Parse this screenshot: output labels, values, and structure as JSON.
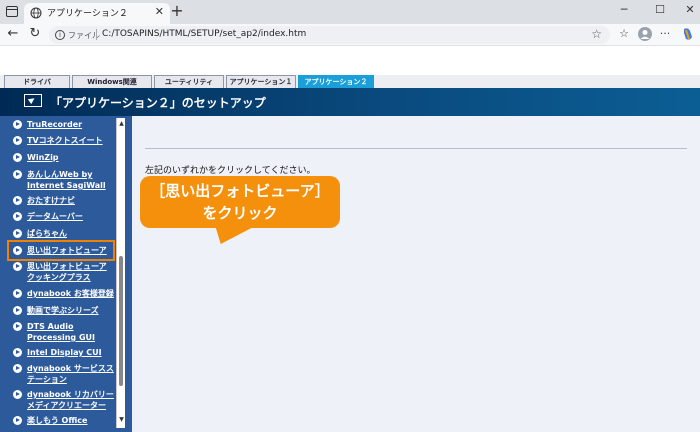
{
  "browser": {
    "tab_title": "アプリケーション２",
    "new_tab": "+",
    "url_scheme": "ファイル",
    "url": "C:/TOSAPINS/HTML/SETUP/set_ap2/index.htm"
  },
  "nav_tabs": [
    "ドライバ",
    "Windows関連",
    "ユーティリティ",
    "アプリケーション１",
    "アプリケーション２"
  ],
  "header": {
    "title": "「アプリケーション２」のセットアップ"
  },
  "sidebar": {
    "items": [
      {
        "label": "TruRecorder"
      },
      {
        "label": "TVコネクトスイート"
      },
      {
        "label": "WinZip"
      },
      {
        "label": "あんしんWeb by\nInternet SagiWall"
      },
      {
        "label": "おたすけナビ"
      },
      {
        "label": "データムーバー"
      },
      {
        "label": "ぱらちゃん"
      },
      {
        "label": "思い出フォトビューア"
      },
      {
        "label": "思い出フォトビューア\nクッキングプラス"
      },
      {
        "label": "dynabook お客様登録"
      },
      {
        "label": "動画で学ぶシリーズ"
      },
      {
        "label": "DTS Audio\nProcessing GUI"
      },
      {
        "label": "Intel Display CUI"
      },
      {
        "label": "dynabook サービスス\nテーション"
      },
      {
        "label": "dynabook リカバリー\nメディアクリエーター"
      },
      {
        "label": "楽しもう Office"
      }
    ]
  },
  "content": {
    "instruction": "左記のいずれかをクリックしてください。"
  },
  "callout": {
    "line1": "［思い出フォトビューア］",
    "line2": "をクリック"
  },
  "colors": {
    "accent": "#f4900c",
    "sidebar": "#2d5a9a",
    "active_tab": "#1b9fd8"
  }
}
